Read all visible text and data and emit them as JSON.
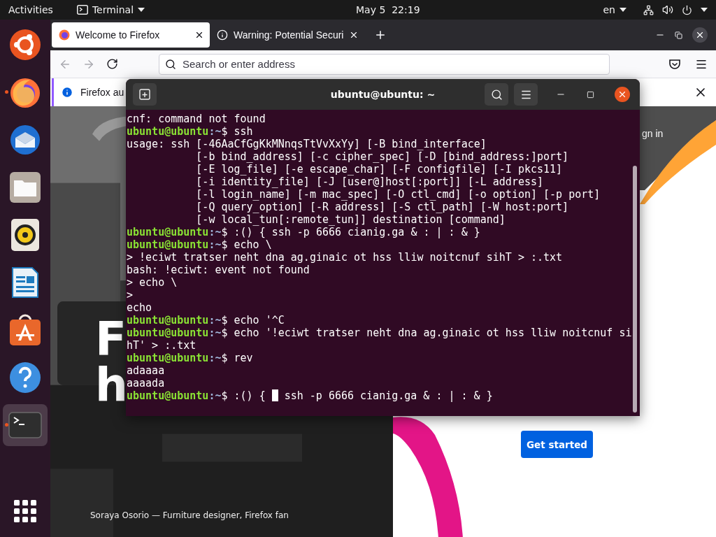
{
  "top_bar": {
    "activities": "Activities",
    "app_menu": "Terminal",
    "clock": "May 5  22:19",
    "keyboard_layout": "en"
  },
  "dock": {
    "items": [
      {
        "kind": "ring-logo",
        "running": false,
        "selected": false
      },
      {
        "kind": "firefox",
        "running": true,
        "selected": false
      },
      {
        "kind": "thunderbird",
        "running": false,
        "selected": false
      },
      {
        "kind": "files",
        "running": false,
        "selected": false
      },
      {
        "kind": "speaker",
        "running": false,
        "selected": false
      },
      {
        "kind": "writer",
        "running": false,
        "selected": false
      },
      {
        "kind": "software",
        "running": false,
        "selected": false
      },
      {
        "kind": "help",
        "running": false,
        "selected": false
      },
      {
        "kind": "terminal",
        "running": true,
        "selected": true
      }
    ]
  },
  "firefox": {
    "tabs": [
      {
        "title": "Welcome to Firefox",
        "kind": "firefox",
        "selected": true
      },
      {
        "title": "Warning: Potential Securi",
        "kind": "warning",
        "selected": false
      }
    ],
    "address_bar": {
      "placeholder": "Search or enter address"
    },
    "notification": {
      "text": "Firefox au"
    },
    "page": {
      "sign_in": "gn in",
      "hero_lines": [
        "F",
        "h"
      ],
      "cta": "Get started",
      "caption": "Soraya Osorio — Furniture designer, Firefox fan"
    }
  },
  "terminal": {
    "title": "ubuntu@ubuntu: ~",
    "lines": [
      {
        "kind": "output",
        "text": "cnf: command not found"
      },
      {
        "kind": "prompt",
        "user": "ubuntu@ubuntu",
        "path": ":~",
        "command": "$ ssh"
      },
      {
        "kind": "output",
        "text": "usage: ssh [-46AaCfGgKkMNnqsTtVvXxYy] [-B bind_interface]"
      },
      {
        "kind": "output",
        "text": "           [-b bind_address] [-c cipher_spec] [-D [bind_address:]port]"
      },
      {
        "kind": "output",
        "text": "           [-E log_file] [-e escape_char] [-F configfile] [-I pkcs11]"
      },
      {
        "kind": "output",
        "text": "           [-i identity_file] [-J [user@]host[:port]] [-L address]"
      },
      {
        "kind": "output",
        "text": "           [-l login_name] [-m mac_spec] [-O ctl_cmd] [-o option] [-p port]"
      },
      {
        "kind": "output",
        "text": "           [-Q query_option] [-R address] [-S ctl_path] [-W host:port]"
      },
      {
        "kind": "output",
        "text": "           [-w local_tun[:remote_tun]] destination [command]"
      },
      {
        "kind": "prompt",
        "user": "ubuntu@ubuntu",
        "path": ":~",
        "command": "$ :() { ssh -p 6666 cianig.ga & : | : & }"
      },
      {
        "kind": "prompt",
        "user": "ubuntu@ubuntu",
        "path": ":~",
        "command": "$ echo \\"
      },
      {
        "kind": "output",
        "text": "> !eciwt tratser neht dna ag.ginaic ot hss lliw noitcnuf sihT > :.txt"
      },
      {
        "kind": "output",
        "text": "bash: !eciwt: event not found"
      },
      {
        "kind": "output",
        "text": "> echo \\"
      },
      {
        "kind": "output",
        "text": ">"
      },
      {
        "kind": "output",
        "text": "echo"
      },
      {
        "kind": "prompt",
        "user": "ubuntu@ubuntu",
        "path": ":~",
        "command": "$ echo '^C"
      },
      {
        "kind": "prompt",
        "user": "ubuntu@ubuntu",
        "path": ":~",
        "command": "$ echo '!eciwt tratser neht dna ag.ginaic ot hss lliw noitcnuf si"
      },
      {
        "kind": "output",
        "text": "hT' > :.txt"
      },
      {
        "kind": "prompt",
        "user": "ubuntu@ubuntu",
        "path": ":~",
        "command": "$ rev"
      },
      {
        "kind": "output",
        "text": "adaaaa"
      },
      {
        "kind": "output",
        "text": "aaaada"
      },
      {
        "kind": "cursor_prompt",
        "user": "ubuntu@ubuntu",
        "path": ":~",
        "command": "$ :() {",
        "after_cursor": "ssh -p 6666 cianig.ga & : | : & }"
      }
    ]
  }
}
